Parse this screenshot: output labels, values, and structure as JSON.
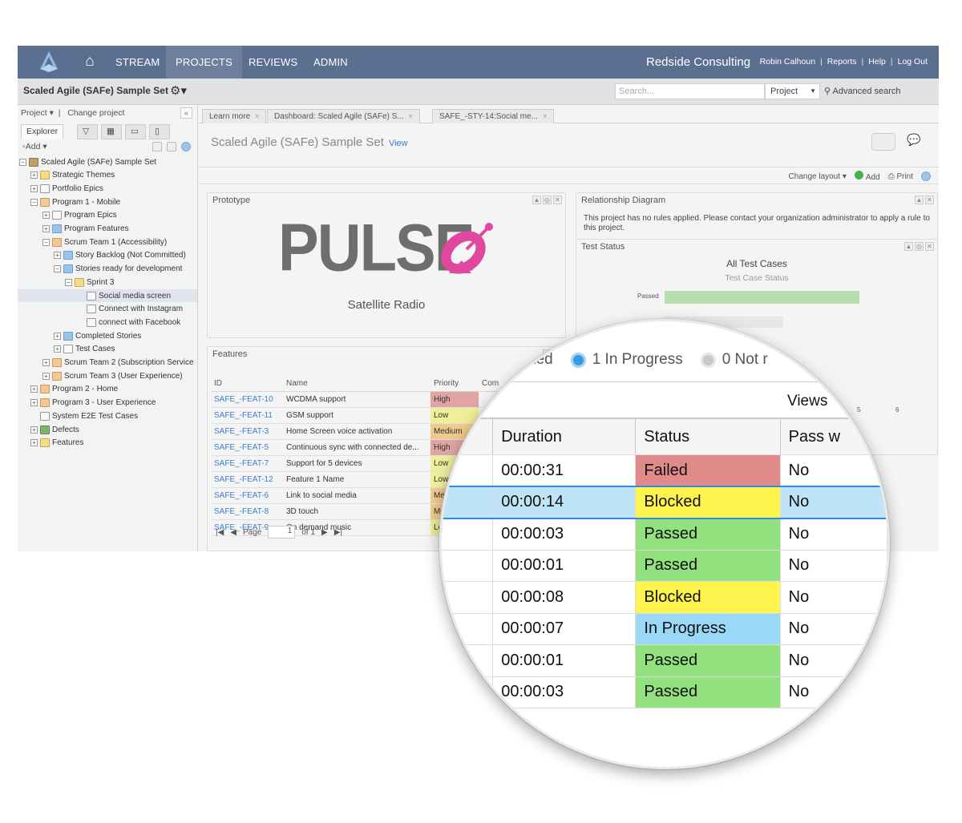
{
  "colors": {
    "nav": "#5b6f90",
    "link": "#3a7ec9",
    "failed": "#e18a8a",
    "blocked": "#fff34d",
    "passed": "#93e07f",
    "in_progress": "#99d8f6",
    "accent_pink": "#e0489f"
  },
  "nav": {
    "items": [
      "STREAM",
      "PROJECTS",
      "REVIEWS",
      "ADMIN"
    ],
    "active": "PROJECTS",
    "brand": "Redside Consulting",
    "links": [
      "Robin Calhoun",
      "Reports",
      "Help",
      "Log Out"
    ]
  },
  "subbar": {
    "project_name": "Scaled Agile (SAFe) Sample Set",
    "search_placeholder": "Search...",
    "scope": "Project",
    "advanced": "Advanced search"
  },
  "sidebar": {
    "project_menu": "Project",
    "change_project": "Change project",
    "tab_explorer": "Explorer",
    "add": "Add",
    "tree": [
      {
        "label": "Scaled Agile (SAFe) Sample Set",
        "icon": "proj",
        "exp": "−"
      },
      {
        "label": "Strategic Themes",
        "icon": "fold",
        "exp": "+"
      },
      {
        "label": "Portfolio Epics",
        "icon": "doc",
        "exp": "+"
      },
      {
        "label": "Program 1 - Mobile",
        "icon": "grid",
        "exp": "−"
      },
      {
        "label": "Program Epics",
        "icon": "doc",
        "exp": "+"
      },
      {
        "label": "Program Features",
        "icon": "blue",
        "exp": "+"
      },
      {
        "label": "Scrum Team 1 (Accessibility)",
        "icon": "grid",
        "exp": "−"
      },
      {
        "label": "Story Backlog (Not Committed)",
        "icon": "blue",
        "exp": "+"
      },
      {
        "label": "Stories ready for development",
        "icon": "blue",
        "exp": "−"
      },
      {
        "label": "Sprint 3",
        "icon": "fold",
        "exp": "−"
      },
      {
        "label": "Social media screen",
        "icon": "doc",
        "exp": ""
      },
      {
        "label": "Connect with Instagram",
        "icon": "doc",
        "exp": ""
      },
      {
        "label": "connect with Facebook",
        "icon": "doc",
        "exp": ""
      },
      {
        "label": "Completed Stories",
        "icon": "blue",
        "exp": "+"
      },
      {
        "label": "Test Cases",
        "icon": "doc",
        "exp": "+"
      },
      {
        "label": "Scrum Team 2 (Subscription Service",
        "icon": "grid",
        "exp": "+"
      },
      {
        "label": "Scrum Team 3 (User Experience)",
        "icon": "grid",
        "exp": "+"
      },
      {
        "label": "Program 2 - Home",
        "icon": "grid",
        "exp": "+"
      },
      {
        "label": "Program 3 - User Experience",
        "icon": "grid",
        "exp": "+"
      },
      {
        "label": "System E2E Test Cases",
        "icon": "doc",
        "exp": ""
      },
      {
        "label": "Defects",
        "icon": "green",
        "exp": "+"
      },
      {
        "label": "Features",
        "icon": "fold",
        "exp": "+"
      }
    ]
  },
  "tabs": [
    "Learn more",
    "Dashboard: Scaled Agile (SAFe) S...",
    "SAFE_-STY-14:Social me..."
  ],
  "dashboard": {
    "title": "Scaled Agile (SAFe) Sample Set",
    "view_link": "View",
    "change_layout": "Change layout",
    "add": "Add",
    "print": "Print"
  },
  "prototype": {
    "title": "Prototype",
    "logo_text": "PULSE",
    "subtitle": "Satellite Radio"
  },
  "relationship": {
    "title": "Relationship Diagram",
    "message": "This project has no rules applied. Please contact your organization administrator to apply a rule to this project."
  },
  "test_status": {
    "title": "Test Status",
    "chart_title": "All Test Cases",
    "chart_subtitle": "Test Case Status",
    "bar_label": "Passed",
    "ticks": [
      "5",
      "6"
    ]
  },
  "features": {
    "title": "Features",
    "columns": [
      "ID",
      "Name",
      "Priority",
      "Com"
    ],
    "rows": [
      {
        "id": "SAFE_-FEAT-10",
        "name": "WCDMA support",
        "priority": "High"
      },
      {
        "id": "SAFE_-FEAT-11",
        "name": "GSM support",
        "priority": "Low"
      },
      {
        "id": "SAFE_-FEAT-3",
        "name": "Home Screen voice activation",
        "priority": "Medium"
      },
      {
        "id": "SAFE_-FEAT-5",
        "name": "Continuous sync with connected de...",
        "priority": "High"
      },
      {
        "id": "SAFE_-FEAT-7",
        "name": "Support for 5 devices",
        "priority": "Low"
      },
      {
        "id": "SAFE_-FEAT-12",
        "name": "Feature 1 Name",
        "priority": "Low"
      },
      {
        "id": "SAFE_-FEAT-6",
        "name": "Link to social media",
        "priority": "Med"
      },
      {
        "id": "SAFE_-FEAT-8",
        "name": "3D touch",
        "priority": "Me"
      },
      {
        "id": "SAFE_-FEAT-9",
        "name": "On demand music",
        "priority": "Lo"
      }
    ],
    "pager": {
      "page_label": "Page",
      "page": "1",
      "of": "of 1"
    }
  },
  "magnifier": {
    "legend_blocked": "ocked",
    "legend_inprogress": "1 In Progress",
    "legend_not": "0 Not r",
    "views": "Views",
    "columns": [
      "Duration",
      "Status",
      "Pass w"
    ],
    "rows": [
      {
        "duration": "00:00:31",
        "status": "Failed",
        "pass": "No"
      },
      {
        "duration": "00:00:14",
        "status": "Blocked",
        "pass": "No",
        "selected": true
      },
      {
        "duration": "00:00:03",
        "status": "Passed",
        "pass": "No"
      },
      {
        "duration": "00:00:01",
        "status": "Passed",
        "pass": "No"
      },
      {
        "duration": "00:00:08",
        "status": "Blocked",
        "pass": "No"
      },
      {
        "duration": "00:00:07",
        "status": "In Progress",
        "pass": "No"
      },
      {
        "duration": "00:00:01",
        "status": "Passed",
        "pass": "No"
      },
      {
        "duration": "00:00:03",
        "status": "Passed",
        "pass": "No"
      }
    ]
  }
}
